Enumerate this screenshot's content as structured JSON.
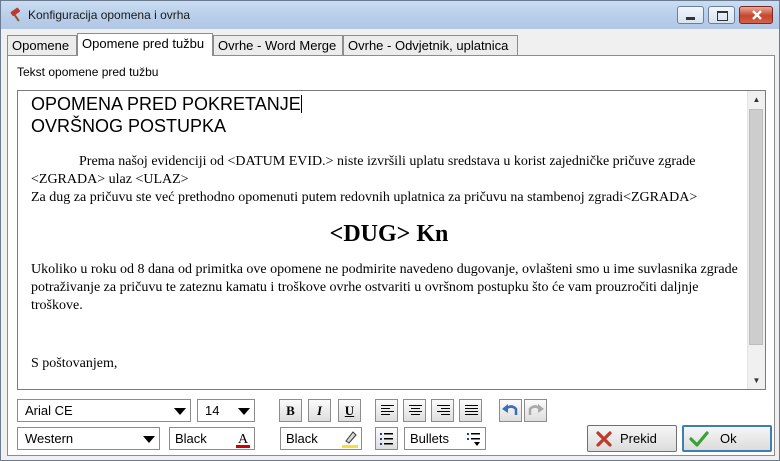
{
  "window": {
    "title": "Konfiguracija opomena i ovrha",
    "icon": "hammer-icon"
  },
  "tabs": [
    {
      "label": "Opomene",
      "active": false
    },
    {
      "label": "Opomene pred tužbu",
      "active": true
    },
    {
      "label": "Ovrhe - Word Merge",
      "active": false
    },
    {
      "label": "Ovrhe - Odvjetnik, uplatnica",
      "active": false
    }
  ],
  "section_label": "Tekst opomene pred tužbu",
  "document": {
    "heading_line1": "OPOMENA PRED POKRETANJE",
    "heading_line2": "OVRŠNOG POSTUPKA",
    "para1": "Prema našoj evidenciji od <DATUM EVID.> niste izvršili uplatu sredstava u korist zajedničke pričuve zgrade <ZGRADA>  ulaz <ULAZ>",
    "para2": "Za dug za pričuvu ste već prethodno opomenuti putem redovnih uplatnica za pričuvu na stambenoj zgradi<ZGRADA>",
    "amount_line": "<DUG> Kn",
    "para3": "Ukoliko u roku od 8 dana od primitka ove opomene ne podmirite navedeno dugovanje, ovlašteni smo u ime suvlasnika zgrade potraživanje za pričuvu te zateznu kamatu i troškove ovrhe ostvariti u ovršnom postupku što će vam prouzročiti daljnje troškove.",
    "closing": "S poštovanjem,"
  },
  "toolbar": {
    "font_name": "Arial CE",
    "font_size": "14",
    "bold_label": "B",
    "italic_label": "I",
    "underline_label": "U",
    "script": "Western",
    "font_color": "Black",
    "highlight_color": "Black",
    "bullets": "Bullets"
  },
  "buttons": {
    "cancel": "Prekid",
    "ok": "Ok"
  },
  "colors": {
    "cancel_icon": "#c0392b",
    "ok_icon": "#3aa235",
    "undo_icon": "#3d6fb6",
    "highlighter": "#f4e23b"
  }
}
